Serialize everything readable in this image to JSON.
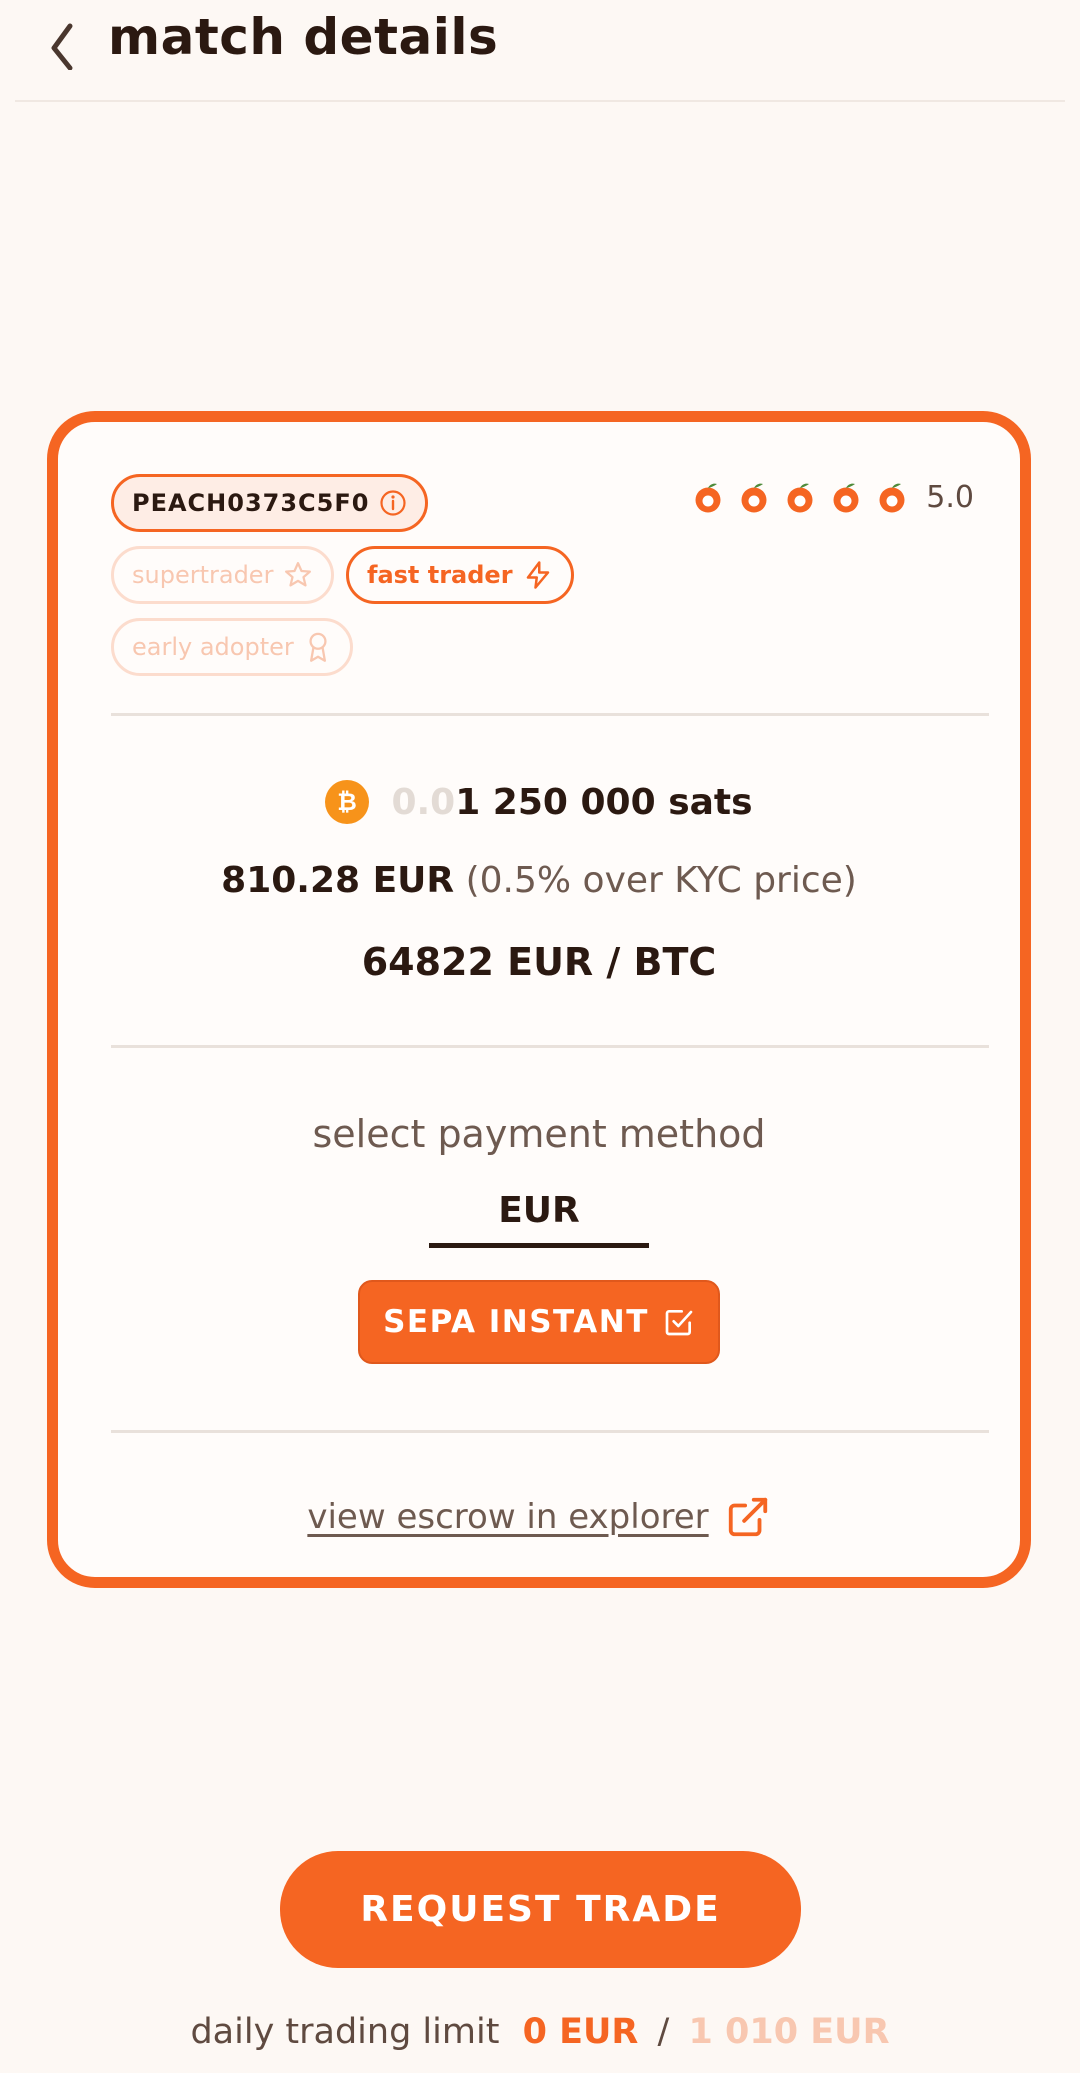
{
  "header": {
    "back_icon": "chevron-left-icon",
    "title": "match details"
  },
  "card": {
    "trader_id": "PEACH0373C5F0",
    "badges": {
      "supertrader": "supertrader",
      "fast_trader": "fast trader",
      "early_adopter": "early adopter"
    },
    "rating": {
      "value": "5.0",
      "score": 5,
      "max": 5
    },
    "amount": {
      "faded_prefix": "0.0",
      "value": "1 250 000",
      "unit": "sats"
    },
    "price": {
      "value": "810.28 EUR",
      "premium_note": "(0.5% over KYC price)"
    },
    "btc_rate": "64822 EUR / BTC",
    "payment": {
      "label": "select payment method",
      "currency": "EUR",
      "method": "SEPA INSTANT"
    },
    "explorer_link": "view escrow in explorer"
  },
  "request_button": "REQUEST TRADE",
  "daily_limit": {
    "label": "daily trading limit",
    "used": "0 EUR",
    "separator": "/",
    "max": "1 010 EUR"
  },
  "colors": {
    "accent": "#F56522",
    "background": "#FDF8F4",
    "text": "#2B1911",
    "muted": "#F8C7B0",
    "bitcoin": "#F7931A"
  }
}
